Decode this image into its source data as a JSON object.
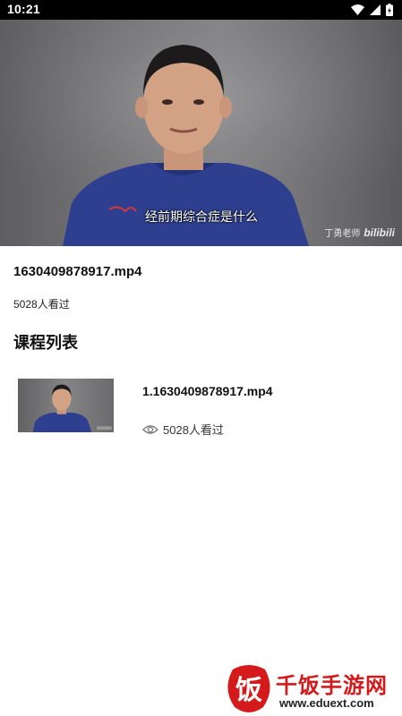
{
  "status_bar": {
    "time": "10:21"
  },
  "video": {
    "subtitle": "经前期综合症是什么",
    "watermark_name": "丁勇老师",
    "watermark_brand": "bilibili"
  },
  "video_info": {
    "title": "1630409878917.mp4",
    "views": "5028人看过"
  },
  "section": {
    "title": "课程列表"
  },
  "course_list": [
    {
      "name": "1.1630409878917.mp4",
      "views": "5028人看过"
    }
  ],
  "site_logo": {
    "glyph": "饭",
    "name": "千饭手游网",
    "url": "www.eduext.com"
  },
  "colors": {
    "logo_red": "#d41a1a",
    "shirt_blue": "#2d3f8e",
    "status_bar": "#000000"
  }
}
